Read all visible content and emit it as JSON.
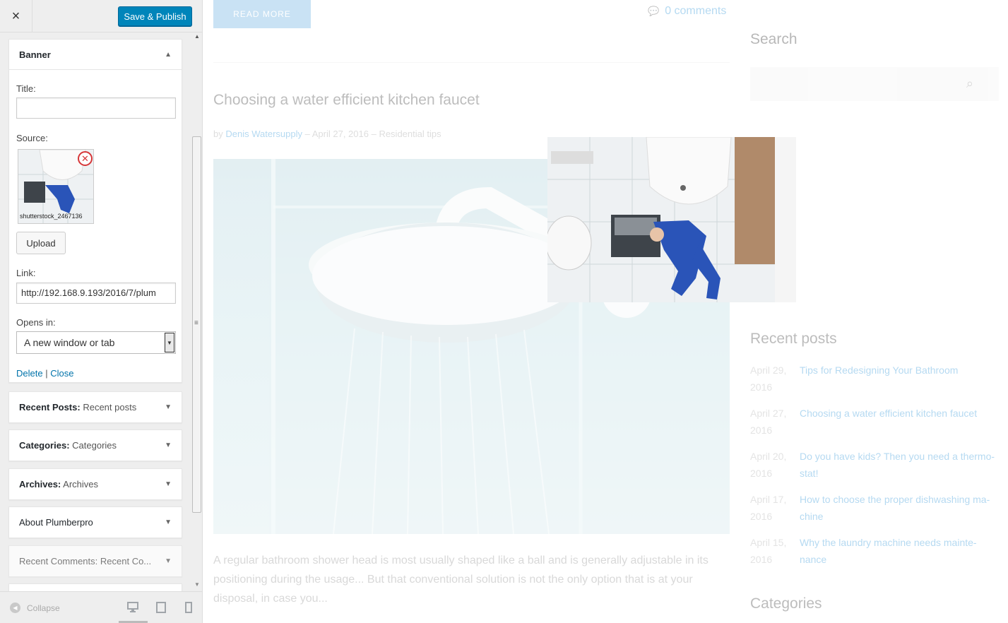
{
  "header": {
    "close_glyph": "×",
    "save_label": "Save & Publish"
  },
  "banner_widget": {
    "title": "Banner",
    "title_label": "Title:",
    "title_value": "",
    "source_label": "Source:",
    "image_caption": "shutterstock_2467136",
    "remove_glyph": "✕",
    "upload_label": "Upload",
    "link_label": "Link:",
    "link_value": "http://192.168.9.193/2016/7/plum",
    "opens_label": "Opens in:",
    "opens_value": "A new window or tab",
    "delete_label": "Delete",
    "separator": "|",
    "close_label": "Close"
  },
  "widgets": [
    {
      "name": "Recent Posts:",
      "sub": "Recent posts"
    },
    {
      "name": "Categories:",
      "sub": "Categories"
    },
    {
      "name": "Archives:",
      "sub": "Archives"
    },
    {
      "name": "About Plumberpro",
      "sub": ""
    },
    {
      "name": "Recent Comments:",
      "sub": "Recent Co..."
    }
  ],
  "footer": {
    "collapse_label": "Collapse"
  },
  "preview": {
    "read_more": "READ MORE",
    "comments": "0 comments",
    "post_title": "Choosing a water efficient kitchen faucet",
    "meta_by": "by",
    "meta_author": "Denis Watersupply",
    "meta_sep1": " – ",
    "meta_date": "April 27, 2016",
    "meta_sep2": " – ",
    "meta_category": "Residential tips",
    "excerpt": "A regular bathroom shower head is most usually shaped like a ball and is generally adjustable in its positioning during the usage... But that conventional solution is not the only option that is at your disposal, in case you...",
    "search_title": "Search",
    "recent_title": "Recent posts",
    "recent_posts": [
      {
        "date": "April 29, 2016",
        "title": "Tips for Redesigning Your Bathroom"
      },
      {
        "date": "April 27, 2016",
        "title": "Choosing a water efficient kitchen faucet"
      },
      {
        "date": "April 20, 2016",
        "title": "Do you have kids? Then you need a thermo-stat!"
      },
      {
        "date": "April 17, 2016",
        "title": "How to choose the proper dishwashing ma-chine"
      },
      {
        "date": "April 15, 2016",
        "title": "Why the laundry machine needs mainte-nance"
      }
    ],
    "categories_title": "Categories"
  },
  "colors": {
    "primary_button": "#0085ba",
    "link": "#0073aa",
    "preview_link": "#1a8ad4",
    "remove_icon": "#d63638"
  }
}
